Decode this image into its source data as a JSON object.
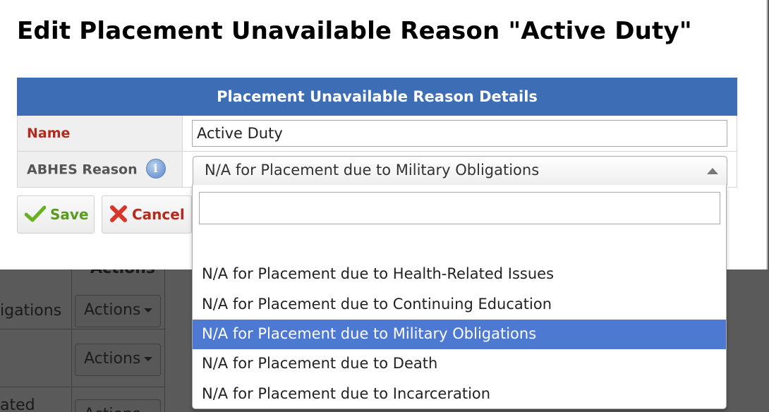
{
  "background": {
    "header_fragment": "Actions",
    "row_fragments": [
      "igations",
      "ated"
    ],
    "actions_label": "Actions"
  },
  "modal": {
    "title": "Edit Placement Unavailable Reason \"Active Duty\"",
    "section_header": "Placement Unavailable Reason Details",
    "fields": {
      "name_label": "Name",
      "name_value": "Active Duty",
      "abhes_label": "ABHES Reason",
      "abhes_value": "N/A for Placement due to Military Obligations"
    },
    "buttons": {
      "save": "Save",
      "cancel": "Cancel"
    }
  },
  "dropdown": {
    "search_value": "",
    "options": [
      {
        "label": "",
        "selected": false
      },
      {
        "label": "N/A for Placement due to Health-Related Issues",
        "selected": false
      },
      {
        "label": "N/A for Placement due to Continuing Education",
        "selected": false
      },
      {
        "label": "N/A for Placement due to Military Obligations",
        "selected": true
      },
      {
        "label": "N/A for Placement due to Death",
        "selected": false
      },
      {
        "label": "N/A for Placement due to Incarceration",
        "selected": false
      }
    ]
  },
  "colors": {
    "header_blue": "#3d6db5",
    "selected_blue": "#4d79d3",
    "required_red": "#b32b1e",
    "save_green": "#5a9a1e"
  },
  "icons": {
    "info": "info-icon",
    "save": "check-icon",
    "cancel": "x-icon",
    "select_arrow": "chevron-up-icon"
  }
}
